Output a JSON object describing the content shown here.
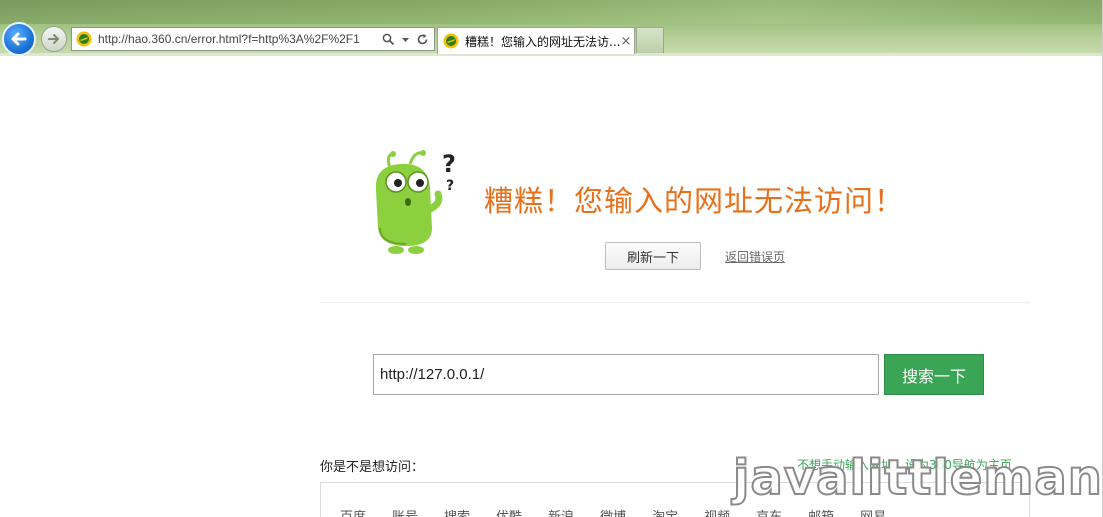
{
  "browser": {
    "address_url": "http://hao.360.cn/error.html?f=http%3A%2F%2F1",
    "tab_title": "糟糕！您输入的网址无法访...",
    "tab_close": "×",
    "accent_color": "#1a73d8"
  },
  "error": {
    "title": "糟糕！您输入的网址无法访问！",
    "refresh_label": "刷新一下",
    "back_link": "返回错误页",
    "title_color": "#e8701a"
  },
  "search": {
    "value": "http://127.0.0.1/",
    "button_label": "搜索一下",
    "button_color": "#3aa655"
  },
  "suggest": {
    "label": "你是不是想访问：",
    "home_link": "不想手动输入网址，设为360导航为主页",
    "items": [
      "百度",
      "账号",
      "搜索",
      "优酷",
      "新浪",
      "微博",
      "淘宝",
      "视频",
      "京东",
      "邮箱",
      "网易"
    ]
  },
  "watermark": "javalittleman"
}
